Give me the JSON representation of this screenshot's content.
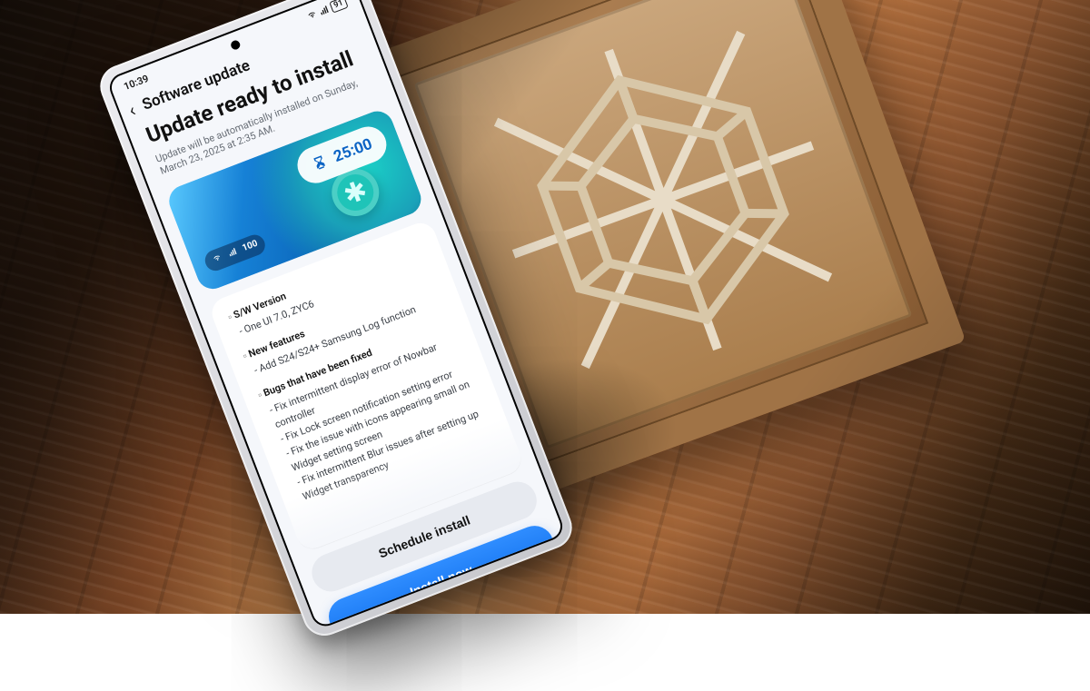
{
  "status_bar": {
    "time": "10:39",
    "battery": "91"
  },
  "header": {
    "title": "Software update"
  },
  "main": {
    "headline": "Update ready to install",
    "schedule_note": "Update will be automatically installed on Sunday, March 23, 2025 at 2:35 AM."
  },
  "promo": {
    "timer": "25:00",
    "signal_caption": "100"
  },
  "release_notes": {
    "sw_version": {
      "heading": "S/W Version",
      "line": "- One UI 7.0, ZYC6"
    },
    "new_features": {
      "heading": "New features",
      "line": "- Add S24/S24+ Samsung Log function"
    },
    "bugs": {
      "heading": "Bugs that have been fixed",
      "items": [
        "- Fix intermittent display error of Nowbar controller",
        "- Fix Lock screen notification setting error",
        "- Fix the issue with icons appearing small on Widget setting screen",
        "- Fix intermittent Blur issues after setting up Widget transparency"
      ]
    }
  },
  "buttons": {
    "schedule": "Schedule install",
    "install": "Install now"
  }
}
